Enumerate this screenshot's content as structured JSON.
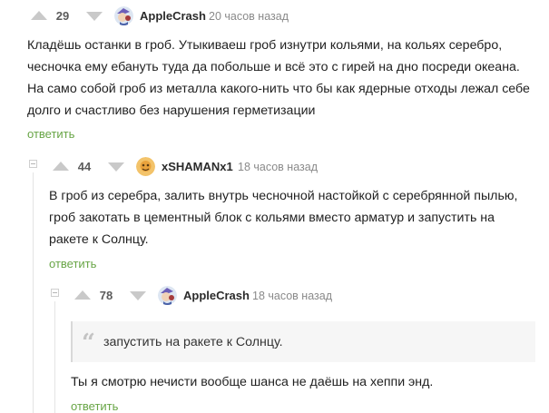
{
  "comments": [
    {
      "score": "29",
      "username": "AppleCrash",
      "time": "20 часов назад",
      "lines": [
        "Кладёшь останки в гроб. Утыкиваеш гроб изнутри кольями, на кольях серебро,",
        "чесночка ему ебануть туда да побольше и всё это с гирей на дно посреди океана.",
        "На само собой гроб из металла какого-нить что бы как ядерные отходы лежал себе",
        "долго и счастливо без нарушения герметизации"
      ],
      "reply_label": "ответить"
    },
    {
      "score": "44",
      "username": "xSHAMANx1",
      "time": "18 часов назад",
      "lines": [
        "В гроб из серебра, залить внутрь чесночной настойкой с серебрянной пылью,",
        "гроб закотать в цементный блок с кольями вместо арматур и запустить на",
        "ракете к Солнцу."
      ],
      "reply_label": "ответить"
    },
    {
      "score": "78",
      "username": "AppleCrash",
      "time": "18 часов назад",
      "quote": "запустить на ракете к Солнцу.",
      "lines": [
        "Ты я смотрю нечисти вообще шанса не даёшь на хеппи энд."
      ],
      "reply_label": "ответить"
    }
  ],
  "icons": {
    "upvote": "upvote-arrow-icon",
    "downvote": "downvote-arrow-icon",
    "collapse": "collapse-thread-icon",
    "quote": "quote-icon"
  },
  "colors": {
    "reply_link": "#68a546",
    "arrow": "#c9c9c9",
    "thread_line": "#e4e4e4"
  }
}
